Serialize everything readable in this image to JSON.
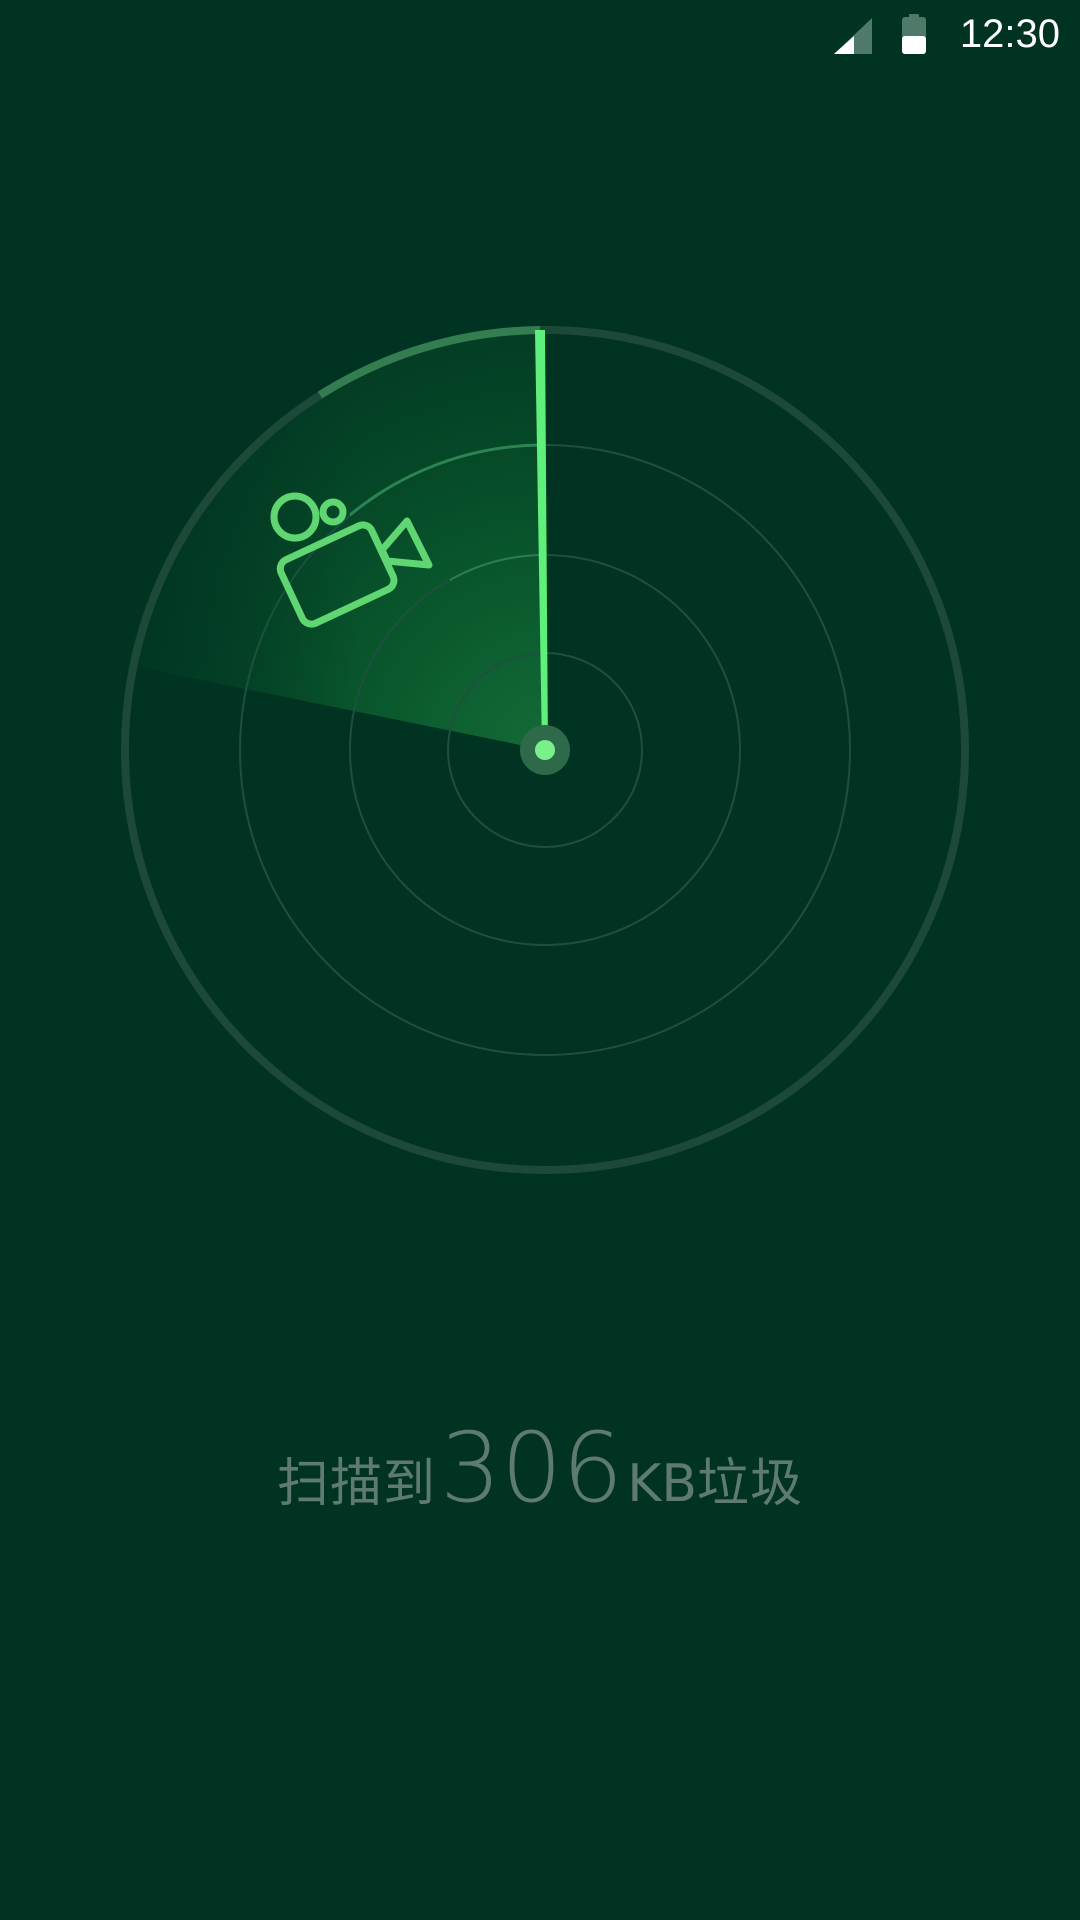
{
  "status_bar": {
    "time": "12:30",
    "signal_icon": "cellular-signal-icon",
    "battery_icon": "battery-icon"
  },
  "radar": {
    "detected_item_icon": "video-camera-icon",
    "colors": {
      "background": "#003322",
      "ring": "#1d4a38",
      "sweep": "#5ef07a",
      "icon": "#5fd672"
    }
  },
  "scan_summary": {
    "prefix": "扫描到",
    "value": "306",
    "unit": "KB",
    "suffix": "垃圾"
  }
}
